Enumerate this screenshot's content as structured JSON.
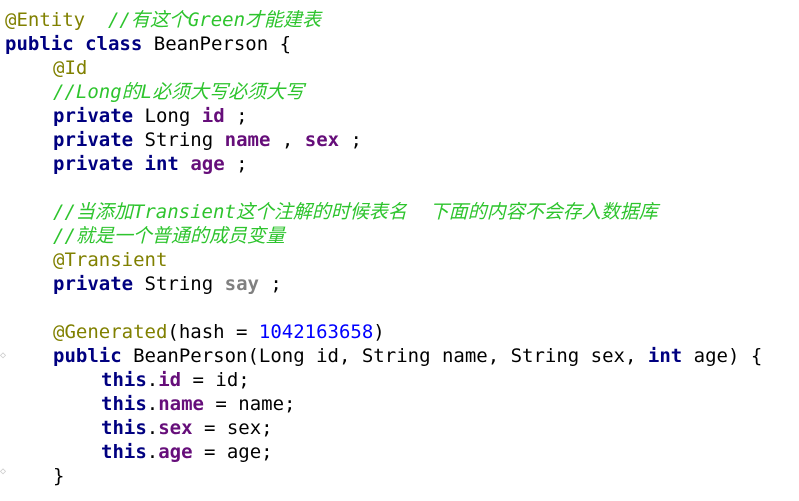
{
  "code": {
    "line01": {
      "annotation": "@Entity",
      "comment": "//有这个Green才能建表"
    },
    "line02": {
      "kw1": "public",
      "kw2": "class",
      "text": "BeanPerson {"
    },
    "line03": {
      "annotation": "@Id"
    },
    "line04": {
      "comment": "//Long的L必须大写必须大写"
    },
    "line05": {
      "kw": "private",
      "type": "Long",
      "field": "id",
      "end": ";"
    },
    "line06": {
      "kw": "private",
      "type": "String",
      "field1": "name",
      "sep": ",",
      "field2": "sex",
      "end": ";"
    },
    "line07": {
      "kw1": "private",
      "kw2": "int",
      "field": "age",
      "end": ";"
    },
    "line09": {
      "comment": "//当添加Transient这个注解的时候表名  下面的内容不会存入数据库"
    },
    "line10": {
      "comment": "//就是一个普通的成员变量"
    },
    "line11": {
      "annotation": "@Transient"
    },
    "line12": {
      "kw": "private",
      "type": "String",
      "field": "say",
      "end": ";"
    },
    "line14": {
      "annotation": "@Generated",
      "open": "(hash = ",
      "number": "1042163658",
      "close": ")"
    },
    "line15": {
      "kw1": "public",
      "text1": "BeanPerson(Long id, String name, String sex,",
      "kw2": "int",
      "text2": "age) {"
    },
    "line16": {
      "kw": "this",
      "dot": ".",
      "field": "id",
      "rest": " = id;"
    },
    "line17": {
      "kw": "this",
      "dot": ".",
      "field": "name",
      "rest": " = name;"
    },
    "line18": {
      "kw": "this",
      "dot": ".",
      "field": "sex",
      "rest": " = sex;"
    },
    "line19": {
      "kw": "this",
      "dot": ".",
      "field": "age",
      "rest": " = age;"
    },
    "line20": {
      "text": "}"
    }
  },
  "colors": {
    "annotation": "#808000",
    "keyword": "#000080",
    "field": "#660e7a",
    "transient_field": "#808080",
    "comment": "#2ec42e",
    "number": "#0000ff"
  }
}
